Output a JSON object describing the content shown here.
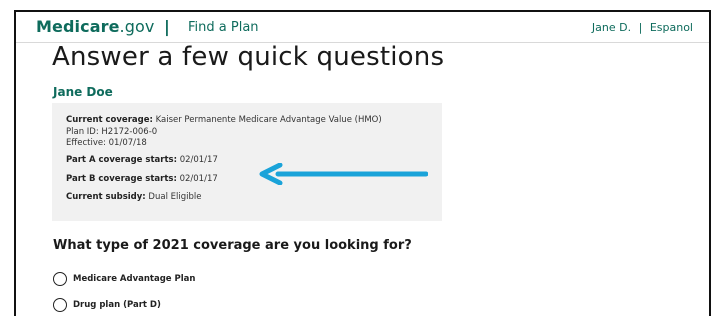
{
  "header": {
    "brand_main": "Medicare",
    "brand_suffix": ".gov",
    "separator": "|",
    "find_plan": "Find a Plan",
    "user_name": "Jane D.",
    "user_sep": "|",
    "language": "Espanol"
  },
  "main": {
    "title": "Answer a few quick questions",
    "member_name": "Jane Doe",
    "coverage": {
      "current_label": "Current coverage:",
      "current_value": "Kaiser Permanente Medicare Advantage Value (HMO)",
      "plan_id": "Plan ID: H2172-006-0",
      "effective": "Effective: 01/07/18",
      "part_a_label": "Part A coverage starts:",
      "part_a_value": "02/01/17",
      "part_b_label": "Part B coverage starts:",
      "part_b_value": "02/01/17",
      "subsidy_label": "Current subsidy:",
      "subsidy_value": "Dual Eligible"
    },
    "question": "What type of 2021  coverage are you looking for?",
    "options": [
      {
        "label": "Medicare Advantage Plan",
        "selected": false
      },
      {
        "label": "Drug plan (Part D)",
        "selected": false
      }
    ]
  },
  "colors": {
    "brand": "#0e6b5c",
    "arrow": "#1aa3d9",
    "box_bg": "#f1f1f1"
  },
  "icons": {
    "annotation_arrow": "left-arrow-icon"
  }
}
